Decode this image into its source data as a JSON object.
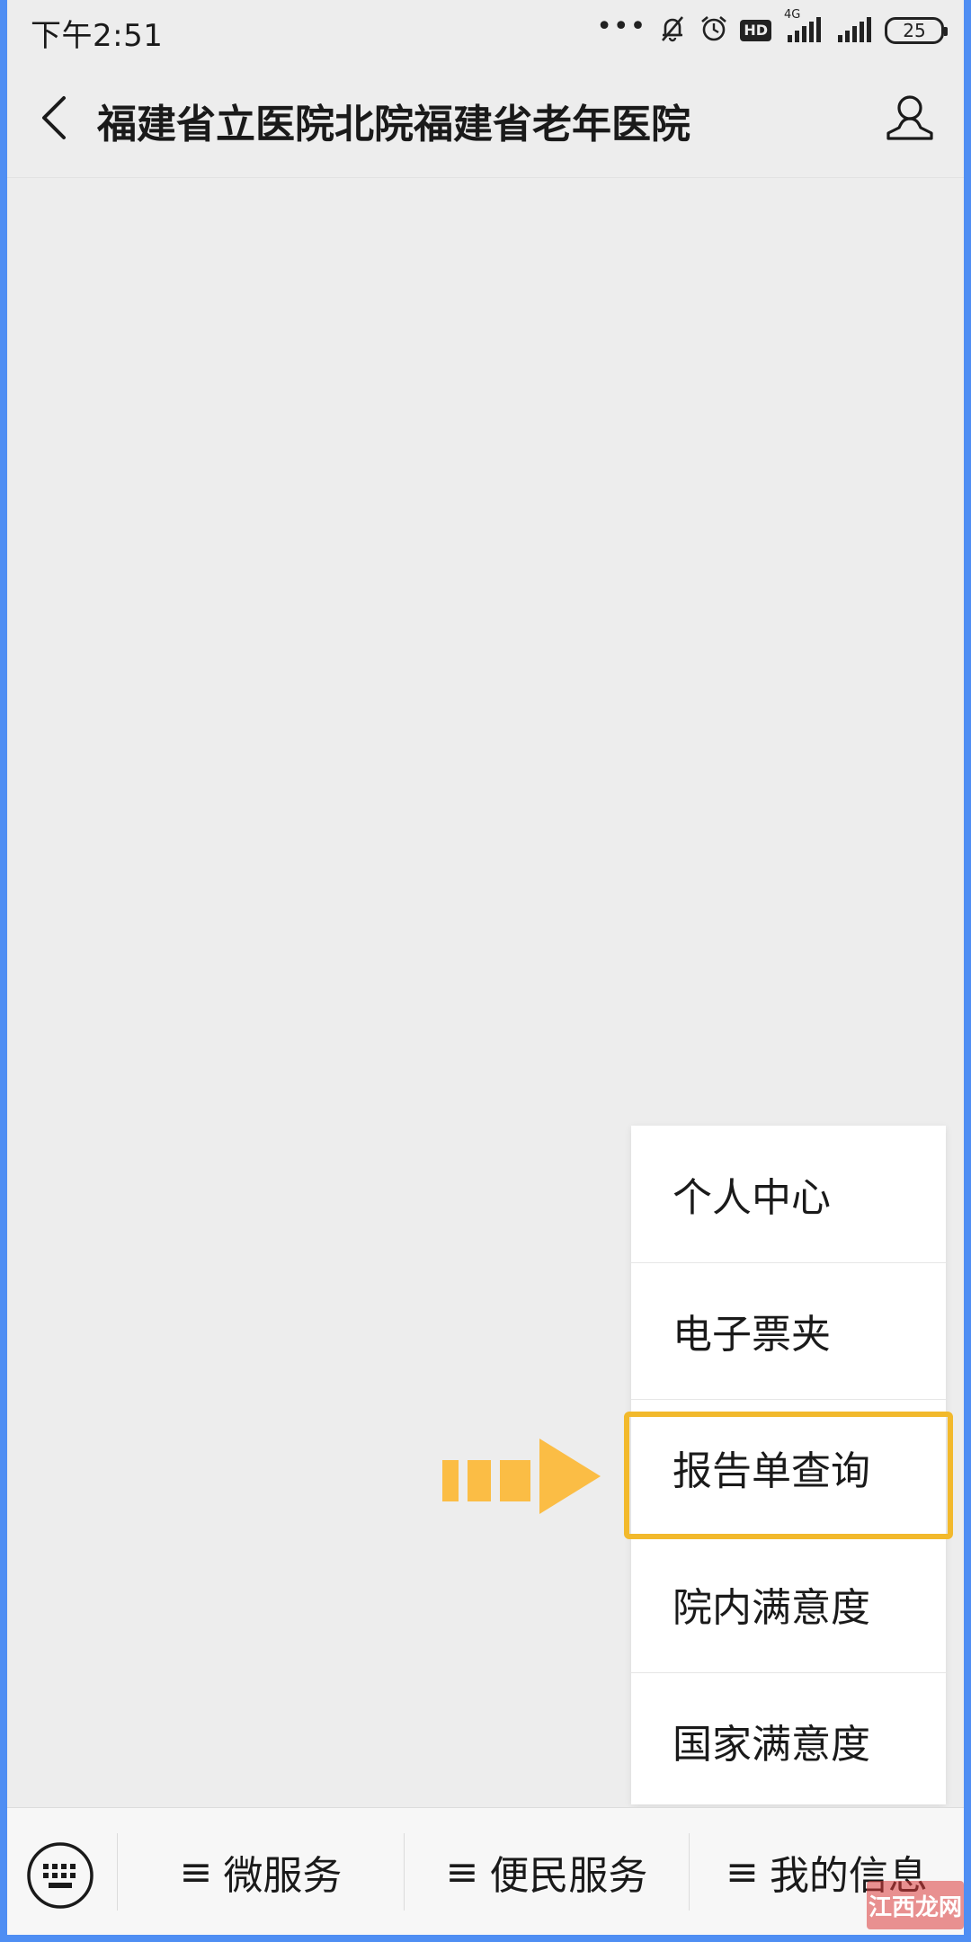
{
  "status_bar": {
    "time": "下午2:51",
    "network_label": "4G",
    "hd_label": "HD",
    "battery_level": "25"
  },
  "title_bar": {
    "title": "福建省立医院北院福建省老年医院"
  },
  "popup_menu": {
    "items": [
      {
        "label": "个人中心"
      },
      {
        "label": "电子票夹"
      },
      {
        "label": "报告单查询",
        "highlighted": true
      },
      {
        "label": "院内满意度"
      },
      {
        "label": "国家满意度"
      }
    ],
    "highlight_color": "#f2b92c"
  },
  "bottom_bar": {
    "tabs": [
      {
        "prefix": "≡",
        "label": "微服务"
      },
      {
        "prefix": "≡",
        "label": "便民服务"
      },
      {
        "prefix": "≡",
        "label": "我的信息"
      }
    ]
  },
  "watermark": {
    "text": "江西龙网"
  },
  "colors": {
    "frame_border": "#4f8ef3",
    "background": "#ededed",
    "arrow": "#fbbd45"
  }
}
